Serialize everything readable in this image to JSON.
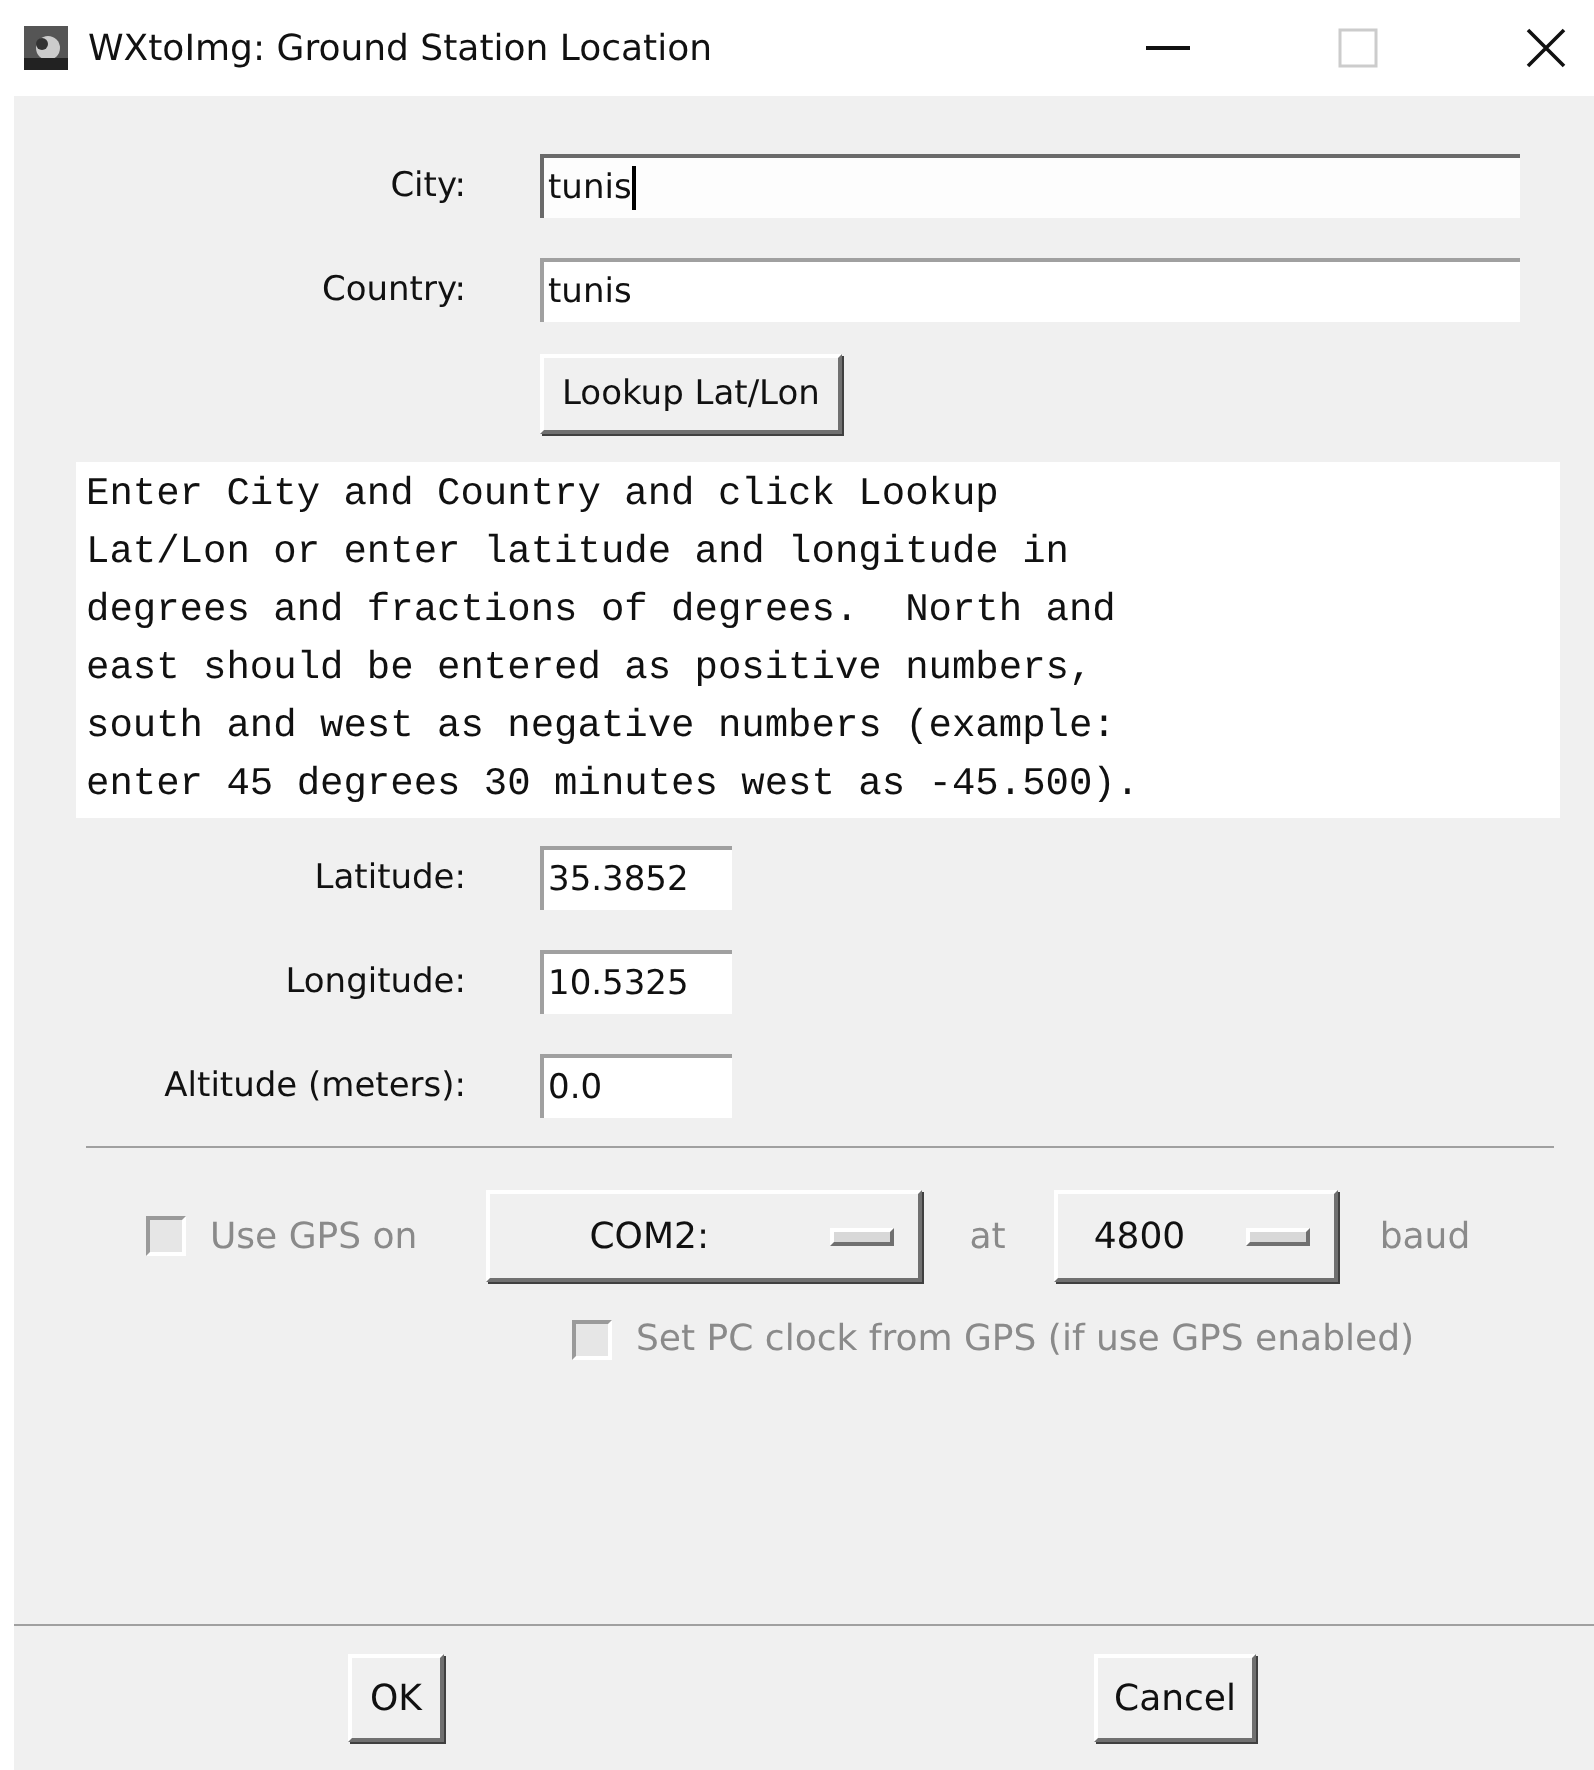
{
  "window": {
    "title": "WXtoImg: Ground Station Location"
  },
  "location_fields": [
    {
      "label": "City:",
      "value": "tunis",
      "focused": true
    },
    {
      "label": "Country:",
      "value": "tunis",
      "focused": false
    }
  ],
  "lookup_button": "Lookup Lat/Lon",
  "help_text": "Enter City and Country and click Lookup\nLat/Lon or enter latitude and longitude in\ndegrees and fractions of degrees.  North and\neast should be entered as positive numbers,\nsouth and west as negative numbers (example:\nenter 45 degrees 30 minutes west as -45.500).",
  "coordinate_fields": [
    {
      "label": "Latitude:",
      "value": "35.3852",
      "focused": false
    },
    {
      "label": "Longitude:",
      "value": "10.5325",
      "focused": false
    },
    {
      "label": "Altitude (meters):",
      "value": "0.0",
      "focused": false
    }
  ],
  "gps": {
    "checkbox": {
      "label": "Use GPS on",
      "checked": false,
      "disabled": true
    },
    "port": "COM2:",
    "at_label": "at",
    "baud": "4800",
    "baud_label": "baud"
  },
  "clock_checkbox": {
    "label": "Set PC clock from GPS (if use GPS enabled)",
    "checked": false,
    "disabled": true
  },
  "buttons": [
    "OK",
    "Cancel"
  ]
}
